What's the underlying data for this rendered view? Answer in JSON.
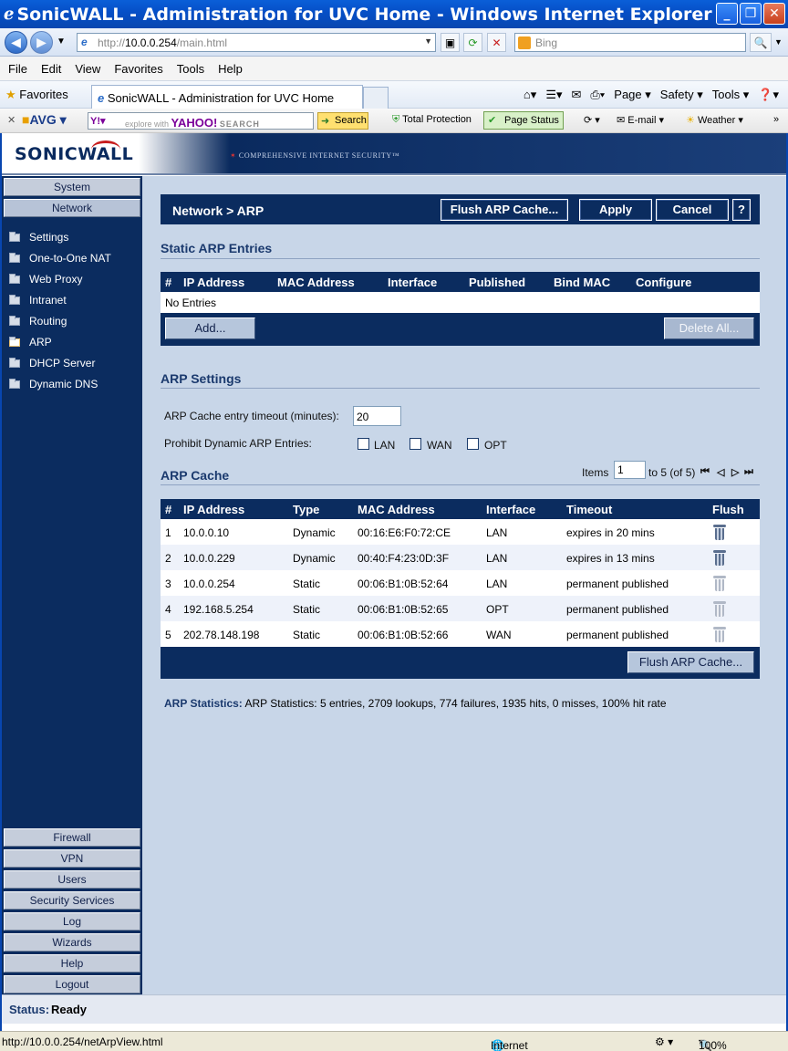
{
  "window": {
    "title": "SonicWALL - Administration for UVC Home - Windows Internet Explorer",
    "controls": [
      "_",
      "❐",
      "✕"
    ]
  },
  "browser": {
    "url_scheme": "http://",
    "url_host": "10.0.0.254",
    "url_path": "/main.html",
    "search_placeholder": "Bing",
    "menu": [
      "File",
      "Edit",
      "View",
      "Favorites",
      "Tools",
      "Help"
    ],
    "favorites_label": "Favorites",
    "tab_title": "SonicWALL - Administration for UVC Home",
    "commands": [
      "Page ▾",
      "Safety ▾",
      "Tools ▾",
      "❓▾"
    ],
    "toolbar": {
      "avg_label": "AVG",
      "yahoo_prefix": "explore with",
      "yahoo_brand": "YAHOO!",
      "yahoo_search": "SEARCH",
      "search_button": "Search",
      "total_protection": "Total Protection",
      "page_status": "Page Status",
      "email": "E-mail ▾",
      "weather": "Weather ▾"
    },
    "status_url": "http://10.0.0.254/netArpView.html",
    "zone": "Internet",
    "zoom": "100%"
  },
  "app": {
    "logo": "SONICWALL",
    "tagline": "COMPREHENSIVE INTERNET SECURITY™",
    "nav_top": [
      "System",
      "Network"
    ],
    "nav_sub": [
      "Settings",
      "One-to-One NAT",
      "Web Proxy",
      "Intranet",
      "Routing",
      "ARP",
      "DHCP Server",
      "Dynamic DNS"
    ],
    "nav_selected": "ARP",
    "nav_bottom": [
      "Firewall",
      "VPN",
      "Users",
      "Security Services",
      "Log",
      "Wizards",
      "Help",
      "Logout"
    ],
    "status_label": "Status:",
    "status_value": "Ready"
  },
  "page": {
    "breadcrumb": "Network > ARP",
    "buttons": {
      "flush": "Flush ARP Cache...",
      "apply": "Apply",
      "cancel": "Cancel",
      "help": "?"
    },
    "static": {
      "title": "Static ARP Entries",
      "columns": [
        "#",
        "IP Address",
        "MAC Address",
        "Interface",
        "Published",
        "Bind MAC",
        "Configure"
      ],
      "empty": "No Entries",
      "add": "Add...",
      "delete_all": "Delete All..."
    },
    "settings": {
      "title": "ARP Settings",
      "timeout_label": "ARP Cache entry timeout (minutes):",
      "timeout_value": "20",
      "prohibit_label": "Prohibit Dynamic ARP Entries:",
      "interfaces": [
        "LAN",
        "WAN",
        "OPT"
      ]
    },
    "cache": {
      "title": "ARP Cache",
      "items_label": "Items",
      "items_value": "1",
      "range": "to 5 (of 5)",
      "columns": [
        "#",
        "IP Address",
        "Type",
        "MAC Address",
        "Interface",
        "Timeout",
        "Flush"
      ],
      "rows": [
        {
          "n": "1",
          "ip": "10.0.0.10",
          "type": "Dynamic",
          "mac": "00:16:E6:F0:72:CE",
          "iface": "LAN",
          "timeout": "expires in 20 mins"
        },
        {
          "n": "2",
          "ip": "10.0.0.229",
          "type": "Dynamic",
          "mac": "00:40:F4:23:0D:3F",
          "iface": "LAN",
          "timeout": "expires in 13 mins"
        },
        {
          "n": "3",
          "ip": "10.0.0.254",
          "type": "Static",
          "mac": "00:06:B1:0B:52:64",
          "iface": "LAN",
          "timeout": "permanent published"
        },
        {
          "n": "4",
          "ip": "192.168.5.254",
          "type": "Static",
          "mac": "00:06:B1:0B:52:65",
          "iface": "OPT",
          "timeout": "permanent published"
        },
        {
          "n": "5",
          "ip": "202.78.148.198",
          "type": "Static",
          "mac": "00:06:B1:0B:52:66",
          "iface": "WAN",
          "timeout": "permanent published"
        }
      ],
      "flush_button": "Flush ARP Cache..."
    },
    "stats_label": "ARP Statistics:",
    "stats_value": "ARP Statistics: 5 entries, 2709 lookups, 774 failures, 1935 hits, 0 misses, 100% hit rate"
  }
}
